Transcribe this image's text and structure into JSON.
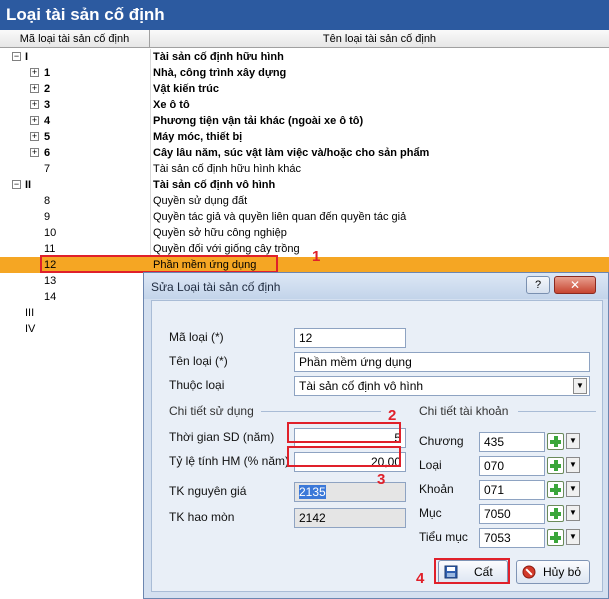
{
  "window": {
    "title": "Loại tài sản cố định"
  },
  "columns": {
    "code": "Mã loại tài sản cố định",
    "name": "Tên loại tài sản cố định"
  },
  "tree": [
    {
      "code": "I",
      "name": "Tài sản cố định hữu hình",
      "bold": true,
      "level": 0,
      "toggle": "−"
    },
    {
      "code": "1",
      "name": "Nhà, công trình xây dựng",
      "bold": true,
      "level": 1,
      "toggle": "+"
    },
    {
      "code": "2",
      "name": "Vật kiến trúc",
      "bold": true,
      "level": 1,
      "toggle": "+"
    },
    {
      "code": "3",
      "name": "Xe ô tô",
      "bold": true,
      "level": 1,
      "toggle": "+"
    },
    {
      "code": "4",
      "name": "Phương tiện vận tải khác (ngoài xe ô tô)",
      "bold": true,
      "level": 1,
      "toggle": "+"
    },
    {
      "code": "5",
      "name": "Máy móc, thiết bị",
      "bold": true,
      "level": 1,
      "toggle": "+"
    },
    {
      "code": "6",
      "name": "Cây lâu năm, súc vật làm việc và/hoặc cho sản phẩm",
      "bold": true,
      "level": 1,
      "toggle": "+"
    },
    {
      "code": "7",
      "name": "Tài sản cố định hữu hình khác",
      "bold": false,
      "level": 1,
      "toggle": ""
    },
    {
      "code": "II",
      "name": "Tài sản cố định vô hình",
      "bold": true,
      "level": 0,
      "toggle": "−"
    },
    {
      "code": "8",
      "name": "Quyền sử dụng đất",
      "bold": false,
      "level": 1,
      "toggle": ""
    },
    {
      "code": "9",
      "name": "Quyền tác giả và quyền liên quan đến quyền tác giả",
      "bold": false,
      "level": 1,
      "toggle": ""
    },
    {
      "code": "10",
      "name": "Quyền sở hữu công nghiệp",
      "bold": false,
      "level": 1,
      "toggle": ""
    },
    {
      "code": "11",
      "name": "Quyền đối với giống cây trồng",
      "bold": false,
      "level": 1,
      "toggle": ""
    },
    {
      "code": "12",
      "name": "Phần mềm ứng dụng",
      "bold": false,
      "level": 1,
      "toggle": "",
      "selected": true
    },
    {
      "code": "13",
      "name": "",
      "bold": false,
      "level": 1,
      "toggle": ""
    },
    {
      "code": "14",
      "name": "",
      "bold": false,
      "level": 1,
      "toggle": ""
    },
    {
      "code": "III",
      "name": "",
      "bold": false,
      "level": 0,
      "toggle": ""
    },
    {
      "code": "IV",
      "name": "",
      "bold": false,
      "level": 0,
      "toggle": ""
    }
  ],
  "markers": {
    "m1": "1",
    "m2": "2",
    "m3": "3",
    "m4": "4"
  },
  "dialog": {
    "title": "Sửa Loại tài sản cố định",
    "help": "?",
    "close": "✕",
    "ma_loai_label": "Mã loại (*)",
    "ma_loai_value": "12",
    "ten_loai_label": "Tên loại (*)",
    "ten_loai_value": "Phần mềm ứng dụng",
    "thuoc_loai_label": "Thuộc loại",
    "thuoc_loai_value": "Tài sản cố định vô hình",
    "section_usage": "Chi tiết sử dụng",
    "section_account": "Chi tiết tài khoản",
    "thoi_gian_label": "Thời gian SD (năm)",
    "thoi_gian_value": "5",
    "ty_le_label": "Tỷ lệ tính HM (% năm)",
    "ty_le_value": "20,00",
    "tk_nguyen_gia_label": "TK nguyên giá",
    "tk_nguyen_gia_value": "2135",
    "tk_hao_mon_label": "TK hao mòn",
    "tk_hao_mon_value": "2142",
    "chuong_label": "Chương",
    "chuong_value": "435",
    "loai_label": "Loại",
    "loai_value": "070",
    "khoan_label": "Khoản",
    "khoan_value": "071",
    "muc_label": "Mục",
    "muc_value": "7050",
    "tieu_muc_label": "Tiểu mục",
    "tieu_muc_value": "7053",
    "save_label": "Cất",
    "cancel_label": "Hủy bỏ"
  }
}
